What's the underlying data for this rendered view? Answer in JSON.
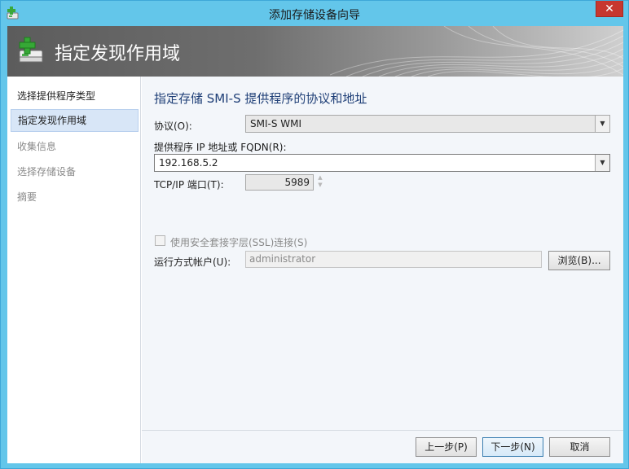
{
  "window": {
    "title": "添加存储设备向导",
    "close_label": "✕"
  },
  "banner": {
    "title": "指定发现作用域"
  },
  "sidebar": {
    "items": [
      {
        "label": "选择提供程序类型"
      },
      {
        "label": "指定发现作用域"
      },
      {
        "label": "收集信息"
      },
      {
        "label": "选择存储设备"
      },
      {
        "label": "摘要"
      }
    ]
  },
  "form": {
    "heading": "指定存储 SMI-S 提供程序的协议和地址",
    "protocol_label": "协议(O):",
    "protocol_value": "SMI-S WMI",
    "address_label": "提供程序 IP 地址或 FQDN(R):",
    "address_value": "192.168.5.2",
    "port_label": "TCP/IP 端口(T):",
    "port_value": "5989",
    "ssl_label": "使用安全套接字层(SSL)连接(S)",
    "runas_label": "运行方式帐户(U):",
    "runas_value": "administrator",
    "browse_label": "浏览(B)..."
  },
  "footer": {
    "prev_label": "上一步(P)",
    "next_label": "下一步(N)",
    "cancel_label": "取消"
  },
  "colors": {
    "titlebar": "#63c6ea",
    "close": "#c7372f",
    "heading": "#1f3f77"
  }
}
